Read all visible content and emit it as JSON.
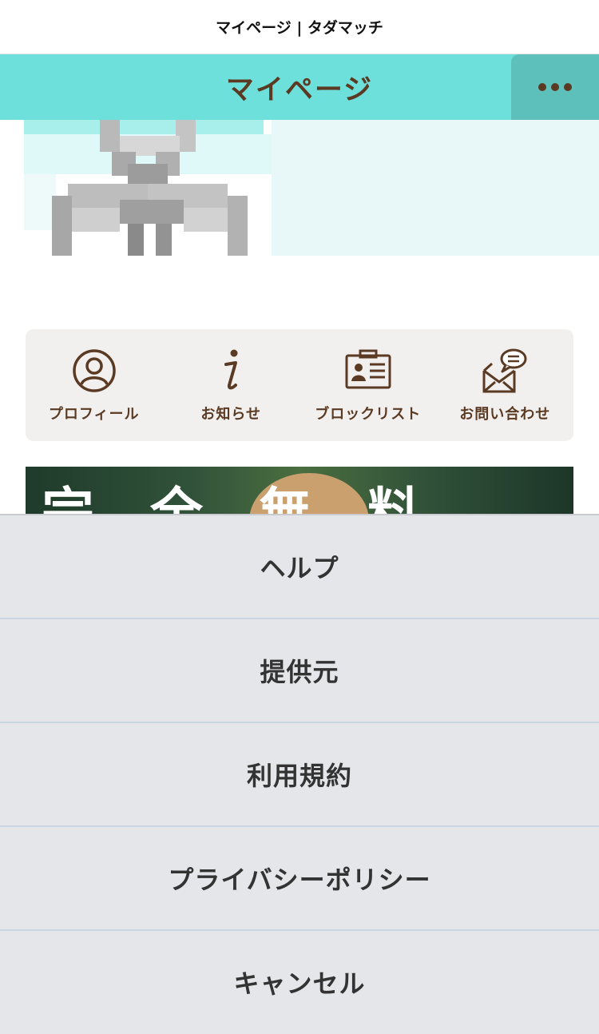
{
  "browser": {
    "page_title": "マイページ | タダマッチ"
  },
  "header": {
    "title": "マイページ",
    "menu_icon": "more-dots-icon"
  },
  "shortcuts": [
    {
      "label": "プロフィール",
      "icon": "person-circle-icon"
    },
    {
      "label": "お知らせ",
      "icon": "info-italic-icon"
    },
    {
      "label": "ブロックリスト",
      "icon": "id-card-icon"
    },
    {
      "label": "お問い合わせ",
      "icon": "mail-chat-icon"
    }
  ],
  "promo": {
    "text": "完全無料"
  },
  "action_sheet": {
    "items": [
      {
        "label": "ヘルプ"
      },
      {
        "label": "提供元"
      },
      {
        "label": "利用規約"
      },
      {
        "label": "プライバシーポリシー"
      },
      {
        "label": "キャンセル"
      }
    ]
  },
  "colors": {
    "header_bg": "#6ee0db",
    "menu_button_bg": "#5dc0bb",
    "brand_brown": "#5a3a22",
    "sheet_bg": "#e5e6e9"
  }
}
